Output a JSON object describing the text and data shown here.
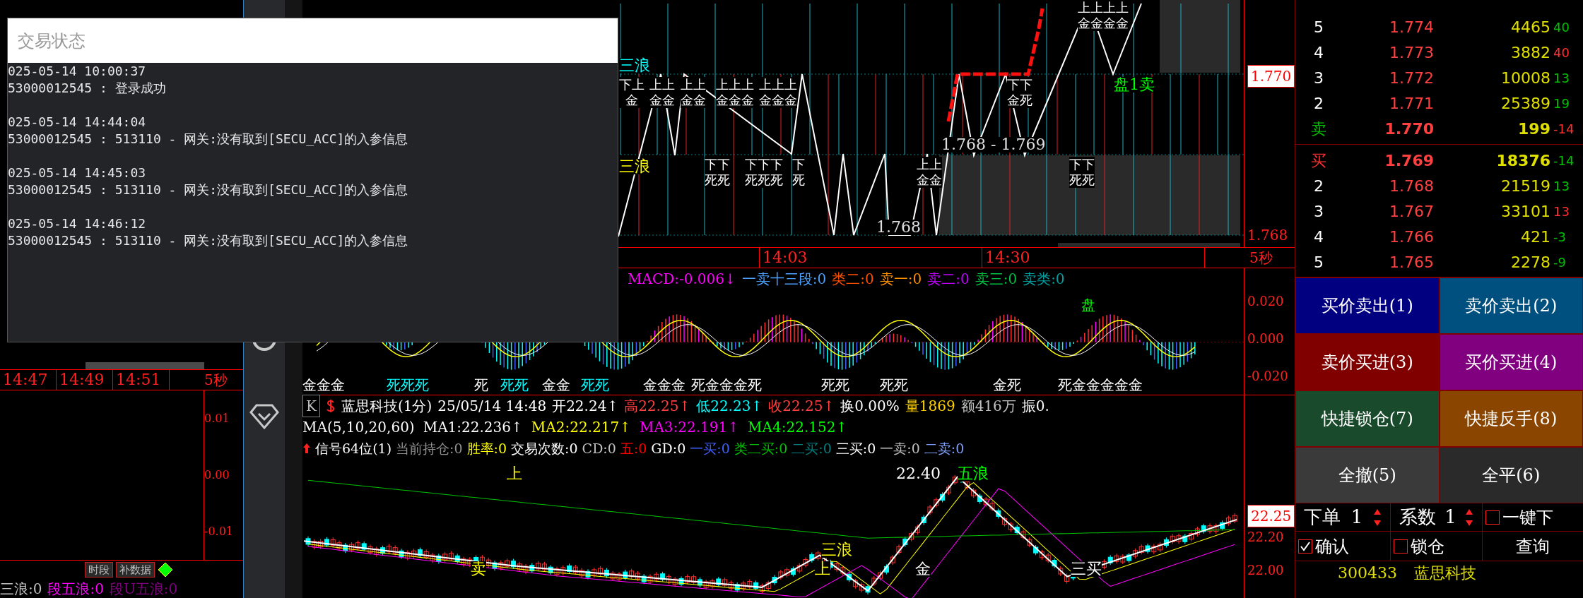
{
  "dialog": {
    "title": "交易状态",
    "log": [
      {
        "time": "025-05-14 10:00:37",
        "message": "53000012545 : 登录成功"
      },
      {
        "time": "025-05-14 14:44:04",
        "message": "53000012545 : 513110 - 网关:没有取到[SECU_ACC]的入参信息"
      },
      {
        "time": "025-05-14 14:45:03",
        "message": "53000012545 : 513110 - 网关:没有取到[SECU_ACC]的入参信息"
      },
      {
        "time": "025-05-14 14:46:12",
        "message": "53000012545 : 513110 - 网关:没有取到[SECU_ACC]的入参信息"
      }
    ]
  },
  "left_panel": {
    "times": [
      "14:47",
      "14:49",
      "14:51"
    ],
    "period": "5秒",
    "y_axis": [
      "0.01",
      "0.00",
      "-0.01"
    ],
    "buttons": [
      "时段",
      "补数据"
    ],
    "stats": [
      {
        "text": "三浪:0",
        "color": "#c0c0c0"
      },
      {
        "text": "段五浪:0",
        "color": "#ff00ff"
      },
      {
        "text": "段U五浪:0",
        "color": "#800080"
      }
    ]
  },
  "top_chart": {
    "price_tag": "1.770",
    "y_axis": [
      "1.768"
    ],
    "times": [
      "14:03",
      "14:30"
    ],
    "period": "5秒",
    "labels": [
      {
        "text": "三浪",
        "color": "#00ffff"
      },
      {
        "text": "三浪",
        "color": "#ffff00"
      },
      {
        "text": "1.768 - 1.769",
        "color": "#e0e0e0"
      },
      {
        "text": "1.768",
        "color": "#e0e0e0"
      },
      {
        "text": "盘1卖",
        "color": "#00ff00"
      }
    ],
    "marks": [
      {
        "top": "上上上上",
        "bottom": "金金金金"
      },
      {
        "top": "下上",
        "bottom": "金"
      },
      {
        "top": "上上",
        "bottom": "金金"
      },
      {
        "top": "上上",
        "bottom": "金金"
      },
      {
        "top": "上上上",
        "bottom": "金金金"
      },
      {
        "top": "上上上",
        "bottom": "金金金"
      },
      {
        "top": "下下",
        "bottom": "金死"
      },
      {
        "top": "下下",
        "bottom": "死死"
      },
      {
        "top": "下下下",
        "bottom": "死死死"
      },
      {
        "top": "下",
        "bottom": "死"
      },
      {
        "top": "上上",
        "bottom": "金金"
      },
      {
        "top": "下下",
        "bottom": "死死"
      }
    ]
  },
  "macd": {
    "title": [
      {
        "text": "MACD:-0.006↓",
        "color": "#ff00ff"
      },
      {
        "text": "一卖十三段:0",
        "color": "#4aa0ff"
      },
      {
        "text": "类二:0",
        "color": "#ff5000"
      },
      {
        "text": "卖一:0",
        "color": "#ff9000"
      },
      {
        "text": "卖二:0",
        "color": "#c000ff"
      },
      {
        "text": "卖三:0",
        "color": "#00c040"
      },
      {
        "text": "卖类:0",
        "color": "#00a0a0"
      }
    ],
    "y_axis": [
      "0.020",
      "0.000",
      "-0.020"
    ],
    "labels": [
      {
        "text": "盘",
        "color": "#00ff00"
      },
      {
        "text": "金金金",
        "color": "#ffffff"
      },
      {
        "text": "死死死",
        "color": "#00ffff"
      },
      {
        "text": "死",
        "color": "#ffffff"
      },
      {
        "text": "死死",
        "color": "#00ffff"
      },
      {
        "text": "金金",
        "color": "#ffffff"
      },
      {
        "text": "死死",
        "color": "#00ffff"
      },
      {
        "text": "金金金",
        "color": "#ffffff"
      },
      {
        "text": "死金金金死",
        "color": "#ffffff"
      },
      {
        "text": "死死",
        "color": "#ffffff"
      },
      {
        "text": "死死",
        "color": "#ffffff"
      },
      {
        "text": "金死",
        "color": "#ffffff"
      },
      {
        "text": "死金金金金金",
        "color": "#ffffff"
      }
    ]
  },
  "kline": {
    "code_box": "K",
    "name": "蓝思科技(1分)",
    "datetime": "25/05/14 14:48",
    "quote": [
      {
        "text": "开22.24↑",
        "color": "#ffffff"
      },
      {
        "text": "高22.25↑",
        "color": "#ff4040"
      },
      {
        "text": "低22.23↑",
        "color": "#00ffff"
      },
      {
        "text": "收22.25↑",
        "color": "#ff4040"
      },
      {
        "text": "换0.00%",
        "color": "#ffffff"
      },
      {
        "text": "量1869",
        "color": "#ffd000"
      },
      {
        "text": "额416万",
        "color": "#c0c0c0"
      },
      {
        "text": "振0.",
        "color": "#ffffff"
      }
    ],
    "ma": [
      {
        "text": "MA(5,10,20,60)",
        "color": "#ffffff"
      },
      {
        "text": "MA1:22.236↑",
        "color": "#ffffff"
      },
      {
        "text": "MA2:22.217↑",
        "color": "#ffff00"
      },
      {
        "text": "MA3:22.191↑",
        "color": "#ff00ff"
      },
      {
        "text": "MA4:22.152↑",
        "color": "#00ff00"
      }
    ],
    "signals": [
      {
        "text": "信号64位(1)",
        "color": "#ffffff"
      },
      {
        "text": "当前持仓:0",
        "color": "#909090"
      },
      {
        "text": "胜率:0",
        "color": "#ffff00"
      },
      {
        "text": "交易次数:0",
        "color": "#ffffff"
      },
      {
        "text": "CD:0",
        "color": "#c0c0c0"
      },
      {
        "text": "五:0",
        "color": "#ff0000"
      },
      {
        "text": "GD:0",
        "color": "#ffffff"
      },
      {
        "text": "一买:0",
        "color": "#4060ff"
      },
      {
        "text": "类二买:0",
        "color": "#00c000"
      },
      {
        "text": "二买:0",
        "color": "#008080"
      },
      {
        "text": "三买:0",
        "color": "#ffffff"
      },
      {
        "text": "一卖:0",
        "color": "#c0c0c0"
      },
      {
        "text": "二卖:0",
        "color": "#80a0ff"
      }
    ],
    "price_tag": "22.25",
    "y_axis": [
      "22.20",
      "22.00"
    ],
    "labels": [
      {
        "text": "上",
        "color": "#ffff00"
      },
      {
        "text": "22.40",
        "color": "#ffffff"
      },
      {
        "text": "五浪",
        "color": "#00ff00"
      },
      {
        "text": "三浪",
        "color": "#ffff00"
      },
      {
        "text": "卖",
        "color": "#ffff00"
      },
      {
        "text": "上",
        "color": "#ffff00"
      },
      {
        "text": "金",
        "color": "#ffffff"
      },
      {
        "text": "三买",
        "color": "#ffffff"
      }
    ]
  },
  "order_book": {
    "asks": [
      {
        "label": "5",
        "price": "1.774",
        "volume": "4465",
        "change": "40",
        "color": "#00c000",
        "best": false
      },
      {
        "label": "4",
        "price": "1.773",
        "volume": "3882",
        "change": "40",
        "color": "#ff3030",
        "best": false
      },
      {
        "label": "3",
        "price": "1.772",
        "volume": "10008",
        "change": "13",
        "color": "#00c000",
        "best": false
      },
      {
        "label": "2",
        "price": "1.771",
        "volume": "25389",
        "change": "19",
        "color": "#00c000",
        "best": false
      },
      {
        "label": "卖",
        "price": "1.770",
        "volume": "199",
        "change": "-14",
        "color": "#ff3030",
        "best": true
      }
    ],
    "bids": [
      {
        "label": "买",
        "price": "1.769",
        "volume": "18376",
        "change": "-14",
        "color": "#00c000",
        "best": true
      },
      {
        "label": "2",
        "price": "1.768",
        "volume": "21519",
        "change": "13",
        "color": "#00c000",
        "best": false
      },
      {
        "label": "3",
        "price": "1.767",
        "volume": "33101",
        "change": "13",
        "color": "#ff3030",
        "best": false
      },
      {
        "label": "4",
        "price": "1.766",
        "volume": "421",
        "change": "-3",
        "color": "#00c000",
        "best": false
      },
      {
        "label": "5",
        "price": "1.765",
        "volume": "2278",
        "change": "-9",
        "color": "#00c000",
        "best": false
      }
    ]
  },
  "trade_buttons": [
    {
      "label": "买价卖出(1)",
      "color": "#000080"
    },
    {
      "label": "卖价卖出(2)",
      "color": "#00507f"
    },
    {
      "label": "卖价买进(3)",
      "color": "#800000"
    },
    {
      "label": "买价买进(4)",
      "color": "#800080"
    },
    {
      "label": "快捷锁仓(7)",
      "color": "#1a4a2c"
    },
    {
      "label": "快捷反手(8)",
      "color": "#8a4600"
    },
    {
      "label": "全撤(5)",
      "color": "#3a3a3a"
    },
    {
      "label": "全平(6)",
      "color": "#2a2a2a"
    }
  ],
  "order_controls": {
    "quantity": {
      "label": "下单",
      "value": "1"
    },
    "factor": {
      "label": "系数",
      "value": "1"
    },
    "one_click": {
      "label": "一键下",
      "checked": false
    },
    "confirm": {
      "label": "确认",
      "checked": true
    },
    "lock": {
      "label": "锁仓",
      "checked": false
    },
    "query": "查询"
  },
  "footer": {
    "code": "300433",
    "name": "蓝思科技"
  }
}
